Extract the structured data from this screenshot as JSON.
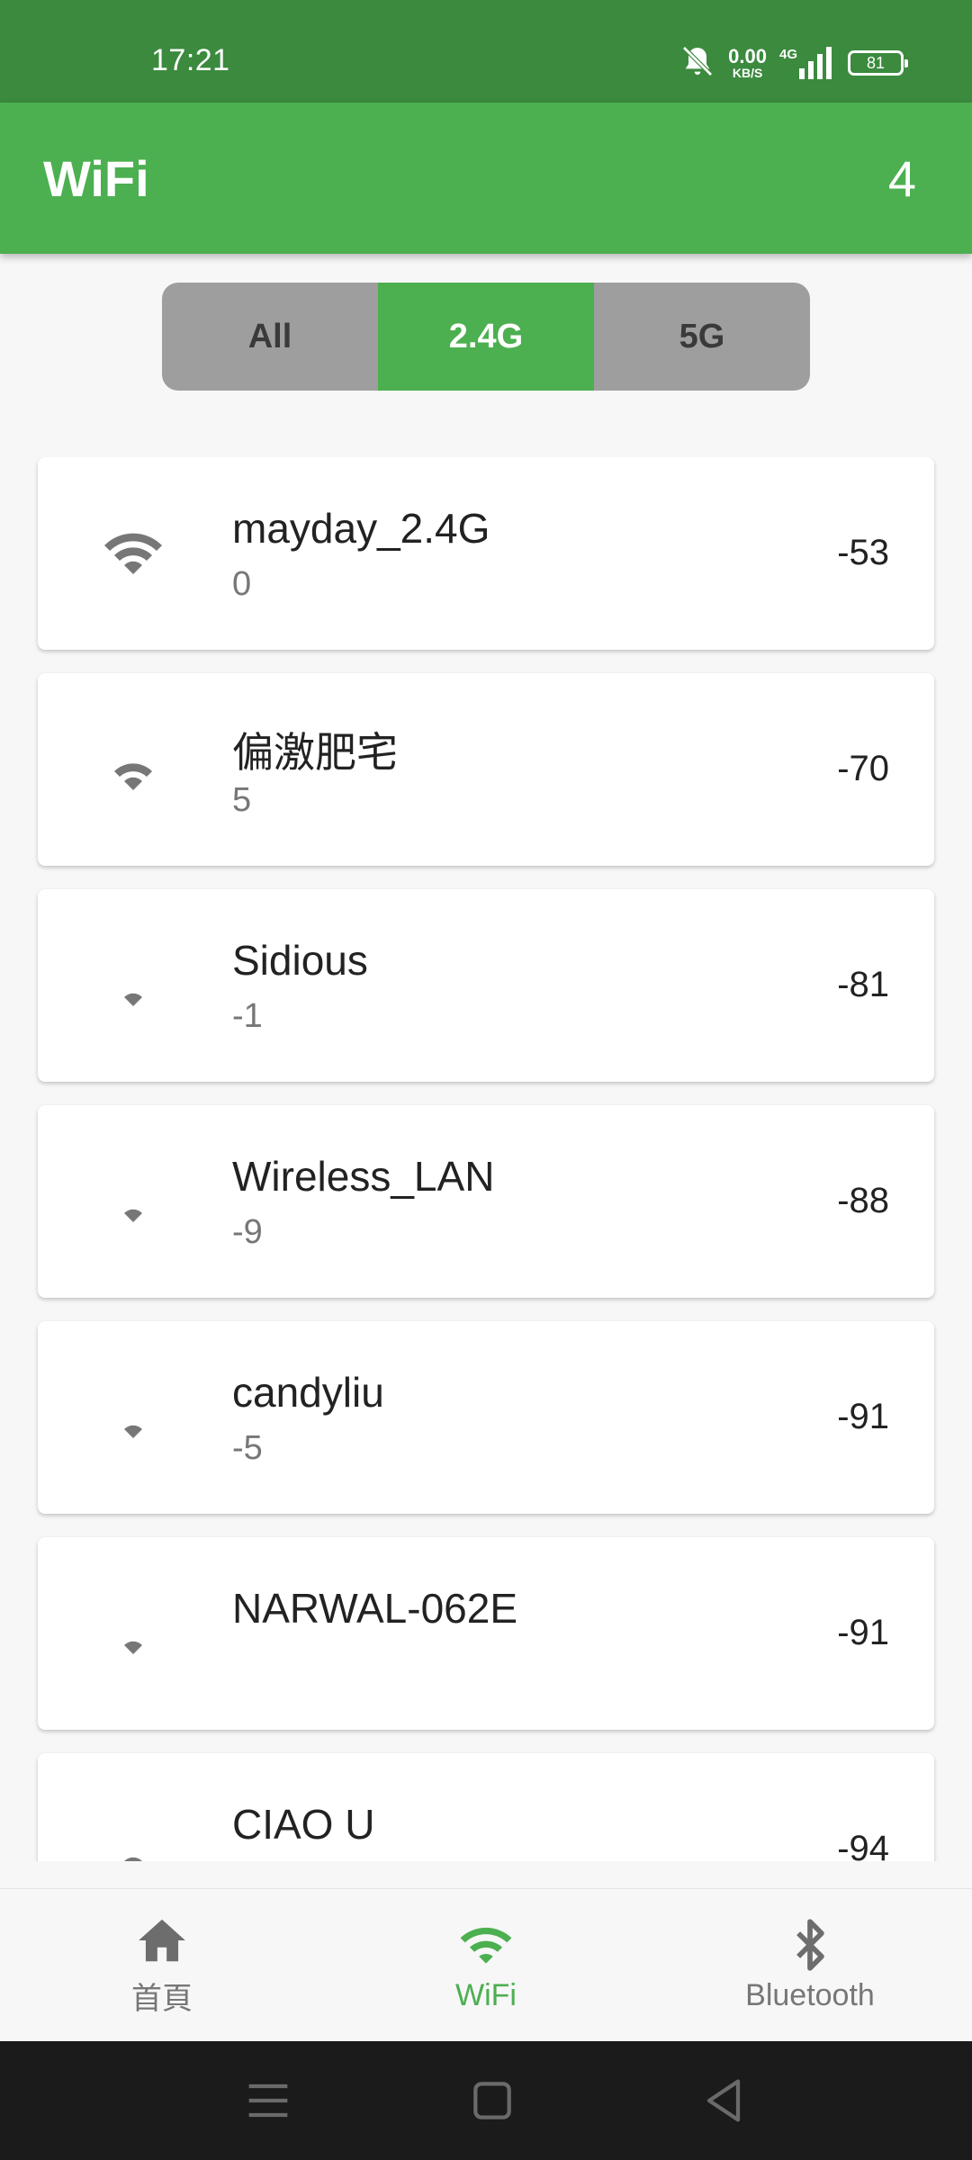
{
  "status_bar": {
    "time": "17:21",
    "net_speed": "0.00",
    "net_unit": "KB/S",
    "network": "4G",
    "battery": "81"
  },
  "app_bar": {
    "title": "WiFi",
    "count": "4"
  },
  "filter": {
    "options": [
      "All",
      "2.4G",
      "5G"
    ],
    "selected": "2.4G"
  },
  "networks": [
    {
      "ssid": "mayday_2.4G",
      "channel": "0",
      "rssi": "-53",
      "strength": 3
    },
    {
      "ssid": "偏激肥宅",
      "channel": "5",
      "rssi": "-70",
      "strength": 2
    },
    {
      "ssid": "Sidious",
      "channel": "-1",
      "rssi": "-81",
      "strength": 1
    },
    {
      "ssid": "Wireless_LAN",
      "channel": "-9",
      "rssi": "-88",
      "strength": 1
    },
    {
      "ssid": "candyliu",
      "channel": "-5",
      "rssi": "-91",
      "strength": 1
    },
    {
      "ssid": "NARWAL-062E",
      "channel": "",
      "rssi": "-91",
      "strength": 1
    },
    {
      "ssid": "CIAO U",
      "channel": "",
      "rssi": "-94",
      "strength": 1
    }
  ],
  "bottom_nav": {
    "items": [
      {
        "label": "首頁",
        "icon": "home-icon"
      },
      {
        "label": "WiFi",
        "icon": "wifi-icon"
      },
      {
        "label": "Bluetooth",
        "icon": "bluetooth-icon"
      }
    ],
    "active": "WiFi"
  },
  "colors": {
    "primary": "#4caf50",
    "status_bar": "#3b8a3e",
    "segment_bg": "#9e9e9e",
    "system_nav": "#1b1b1b"
  }
}
